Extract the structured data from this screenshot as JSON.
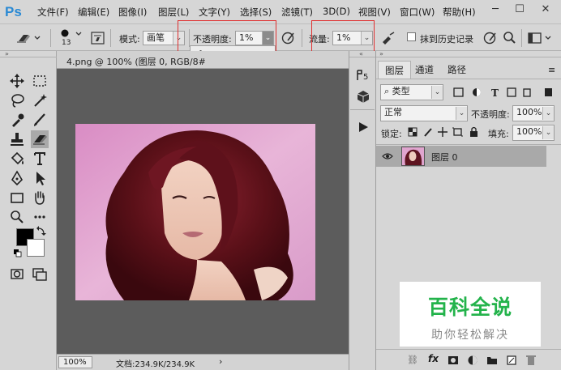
{
  "app": {
    "logo": "Ps"
  },
  "menu": [
    "文件(F)",
    "编辑(E)",
    "图像(I)",
    "图层(L)",
    "文字(Y)",
    "选择(S)",
    "滤镜(T)",
    "3D(D)",
    "视图(V)",
    "窗口(W)",
    "帮助(H)"
  ],
  "window_controls": {
    "minimize": "─",
    "restore": "☐",
    "close": "✕"
  },
  "options": {
    "brush_size": "13",
    "mode_label": "模式:",
    "mode_value": "画笔",
    "opacity_label": "不透明度:",
    "opacity_value": "1%",
    "flow_label": "流量:",
    "flow_value": "1%",
    "erase_history_label": "抹到历史记录",
    "opacity_slider_level": 0.01
  },
  "document": {
    "tab_title": "4.png @ 100% (图层 0, RGB/8#",
    "zoom": "100%",
    "doc_info": "文档:234.9K/234.9K"
  },
  "layers_panel": {
    "tabs": [
      "图层",
      "通道",
      "路径"
    ],
    "filter_kind": "类型",
    "blend_mode": "正常",
    "opacity_label": "不透明度:",
    "opacity_value": "100%",
    "lock_label": "锁定:",
    "fill_label": "填充:",
    "fill_value": "100%",
    "layer_name": "图层 0"
  },
  "watermark": {
    "title": "百科全说",
    "subtitle": "助你轻松解决"
  },
  "colors": {
    "ps_blue": "#2b8ad4",
    "highlight_red": "#e03030",
    "watermark_green": "#23b34b"
  }
}
